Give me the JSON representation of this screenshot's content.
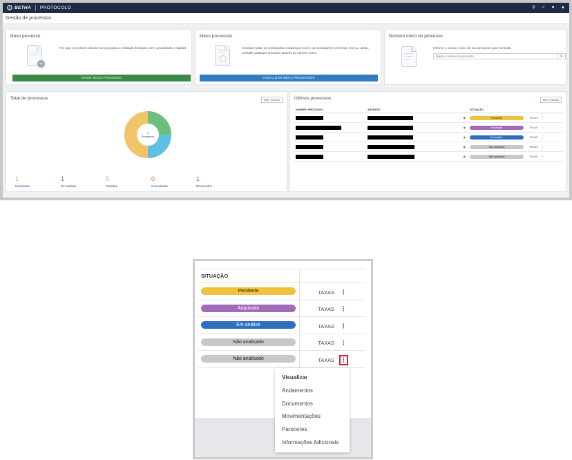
{
  "app": {
    "brand": "BETHA",
    "product": "PROTOCOLO",
    "breadcrumb": "Gestão de processos"
  },
  "cards": {
    "novo": {
      "title": "Novo processo",
      "desc": "Por aqui é possível solicitar serviços para a entidade desejada com comodidade e rapidez.",
      "button": "CRIAR NOVO PROCESSO",
      "button_color": "#3b8a47"
    },
    "meus": {
      "title": "Meus processos",
      "desc": "Consulte todas as solicitações criadas por você e as acompanhe em tempo real ou, ainda, consulte qualquer processo através do número único.",
      "button": "VISUALIZAR MEUS PROCESSOS",
      "button_color": "#2f7ec4"
    },
    "numero": {
      "title": "Número único do processo",
      "desc": "Informe o número único do seu processo para consulta.",
      "placeholder": "Digite o número do processo"
    }
  },
  "total": {
    "title": "Total de processos",
    "ver_todos": "VER TODOS",
    "center_count": "4",
    "center_label": "Processos",
    "stats": [
      {
        "value": "1",
        "label": "Pendentes",
        "color": "#f0a93a"
      },
      {
        "value": "1",
        "label": "Em análise",
        "color": "#3a7fc6"
      },
      {
        "value": "0",
        "label": "Parados",
        "color": "#9aa0a8"
      },
      {
        "value": "0",
        "label": "Cancelados",
        "color": "#e0622b"
      },
      {
        "value": "1",
        "label": "Encerrados",
        "color": "#4a8f57"
      }
    ]
  },
  "chart_data": {
    "type": "pie",
    "donut": true,
    "labels": [
      "Encerrado (verde)",
      "Em análise (azul)",
      "Pendente (amarelo)"
    ],
    "values": [
      1,
      1,
      2
    ],
    "colors": [
      "#6dbf7b",
      "#5ec1df",
      "#f1c468"
    ],
    "center_text": "4 Processos"
  },
  "ultimos": {
    "title": "Últimos processos",
    "ver_todos": "VER TODOS",
    "headers": [
      "NÚMERO PROCESSO",
      "ASSUNTO",
      "SITUAÇÃO"
    ],
    "rows": [
      {
        "status": "Pendente",
        "color": "#f0c23c",
        "taxas": "TAXAS"
      },
      {
        "status": "Arquivado",
        "color": "#a46bb8",
        "taxas": "TAXAS"
      },
      {
        "status": "Em análise",
        "color": "#2f6fc0",
        "taxas": "TAXAS"
      },
      {
        "status": "Não analisado",
        "color": "#c6c8cc",
        "taxas": "TAXAS"
      },
      {
        "status": "Não analisado",
        "color": "#c6c8cc",
        "taxas": "TAXAS"
      }
    ]
  },
  "zoom": {
    "header": "SITUAÇÃO",
    "rows": [
      {
        "status": "Pendente",
        "color": "#f0c23c",
        "light_text": false,
        "taxas": "TAXAS"
      },
      {
        "status": "Arquivado",
        "color": "#a46bb8",
        "light_text": true,
        "taxas": "TAXAS"
      },
      {
        "status": "Em análise",
        "color": "#2f6fc0",
        "light_text": true,
        "taxas": "TAXAS"
      },
      {
        "status": "Não analisado",
        "color": "#c6c8cc",
        "light_text": false,
        "taxas": "TAXAS"
      },
      {
        "status": "Não analisado",
        "color": "#c6c8cc",
        "light_text": false,
        "taxas": "TAXAS"
      }
    ],
    "menu": [
      "Visualizar",
      "Andamentos",
      "Documentos",
      "Movimentações",
      "Pareceres",
      "Informações Adicionais"
    ]
  }
}
